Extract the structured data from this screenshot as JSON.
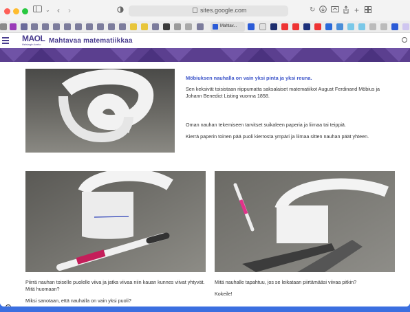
{
  "browser": {
    "url": "sites.google.com",
    "bookmark_tab_label": "Mahtav..."
  },
  "site": {
    "title": "Mahtavaa matematiikkaa",
    "logo_text": "MAOL",
    "logo_subtext": "Helsingin kerho"
  },
  "section1": {
    "heading": "Möbiuksen nauhalla on vain yksi pinta ja yksi reuna.",
    "paragraph1": "Sen keksivät toisistaan riippumatta saksalaiset matematiikot August Ferdinand Möbius ja Johann Benedict Listing vuonna 1858.",
    "paragraph2": "Oman nauhan tekemiseen tarvitset suikaleen paperia ja liimaa tai teippiä.",
    "paragraph3": "Kierrä paperin toinen pää puoli kierrosta ympäri ja liimaa sitten nauhan päät yhteen."
  },
  "section2": {
    "left_caption1": "Piirrä nauhan toiselle puolelle viiva ja jatka viivaa niin kauan kunnes viivat yhtyvät. Mitä huomaan?",
    "left_caption2": "Miksi sanotaan, että nauhalla on vain yksi puoli?",
    "right_caption1": "Mitä nauhalle tapahtuu, jos se leikataan piirtämääsi viivaa pitkin?",
    "right_caption2": "Kokeile!"
  },
  "colors": {
    "accent": "#3d55c9",
    "brand": "#4a3d8f",
    "banner": "#5b3f8f",
    "desktop": "#3b6fe0"
  },
  "icons": [
    "sidebar-icon",
    "back-icon",
    "forward-icon",
    "privacy-icon",
    "lock-icon",
    "reload-icon",
    "download-icon",
    "share-icon",
    "new-tab-icon",
    "tab-overview-icon",
    "menu-icon",
    "search-icon",
    "info-icon"
  ]
}
